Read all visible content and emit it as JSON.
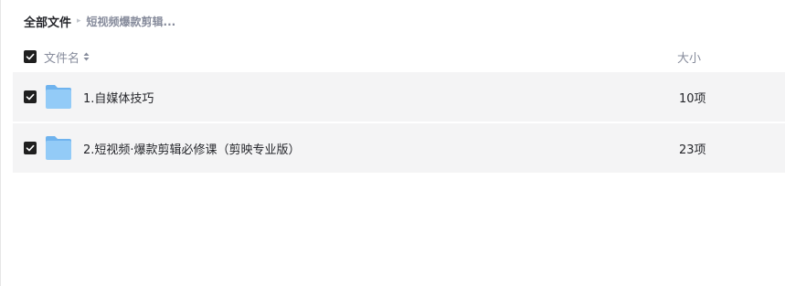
{
  "breadcrumb": {
    "root": "全部文件",
    "separator": "▸",
    "current": "短视频爆款剪辑..."
  },
  "table": {
    "header": {
      "name": "文件名",
      "size": "大小",
      "select_all_checked": true
    },
    "rows": [
      {
        "name": "1.自媒体技巧",
        "size": "10项",
        "type": "folder",
        "checked": true
      },
      {
        "name": "2.短视频·爆款剪辑必修课（剪映专业版）",
        "size": "23项",
        "type": "folder",
        "checked": true
      }
    ]
  },
  "colors": {
    "row_background": "#f4f4f5",
    "checkbox": "#1f1f1f",
    "folder_blue": "#8cc6f5",
    "muted_text": "#878c9c"
  },
  "icons": {
    "folder": "folder-icon",
    "sort": "sort-icon",
    "checkbox": "checkbox-checked-icon"
  }
}
